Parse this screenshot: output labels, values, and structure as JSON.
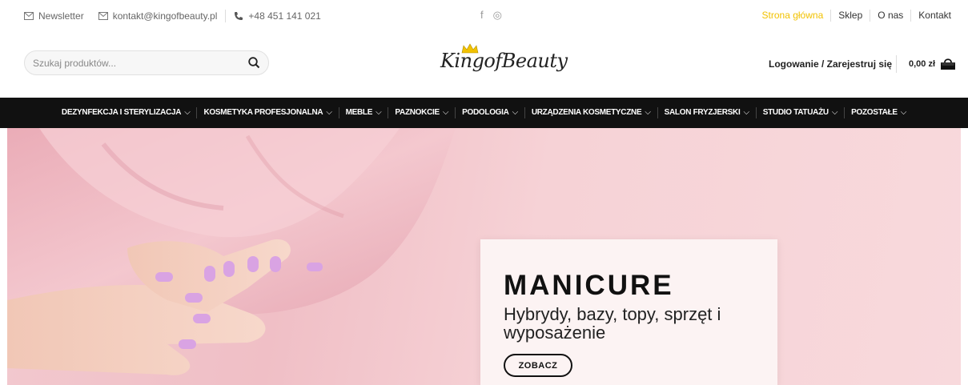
{
  "topbar": {
    "newsletter": "Newsletter",
    "email": "kontakt@kingofbeauty.pl",
    "phone": "+48 451 141 021",
    "social": {
      "facebook": "f",
      "instagram": "◎"
    },
    "nav": [
      {
        "label": "Strona główna",
        "active": true
      },
      {
        "label": "Sklep"
      },
      {
        "label": "O nas"
      },
      {
        "label": "Kontakt"
      }
    ]
  },
  "header": {
    "search_placeholder": "Szukaj produktów...",
    "logo_text": "KingofBeauty",
    "login": "Logowanie / Zarejestruj się",
    "cart_total": "0,00 zł"
  },
  "menu": [
    "DEZYNFEKCJA I STERYLIZACJA",
    "KOSMETYKA PROFESJONALNA",
    "MEBLE",
    "PAZNOKCIE",
    "PODOLOGIA",
    "URZĄDZENIA KOSMETYCZNE",
    "SALON FRYZJERSKI",
    "STUDIO TATUAŻU",
    "POZOSTAŁE"
  ],
  "hero": {
    "title": "MANICURE",
    "subtitle": "Hybrydy, bazy, topy, sprzęt i wyposażenie",
    "button": "ZOBACZ"
  },
  "colors": {
    "accent": "#f2c200",
    "menu_bg": "#111111",
    "hero_bg": "#f2c9cf"
  }
}
